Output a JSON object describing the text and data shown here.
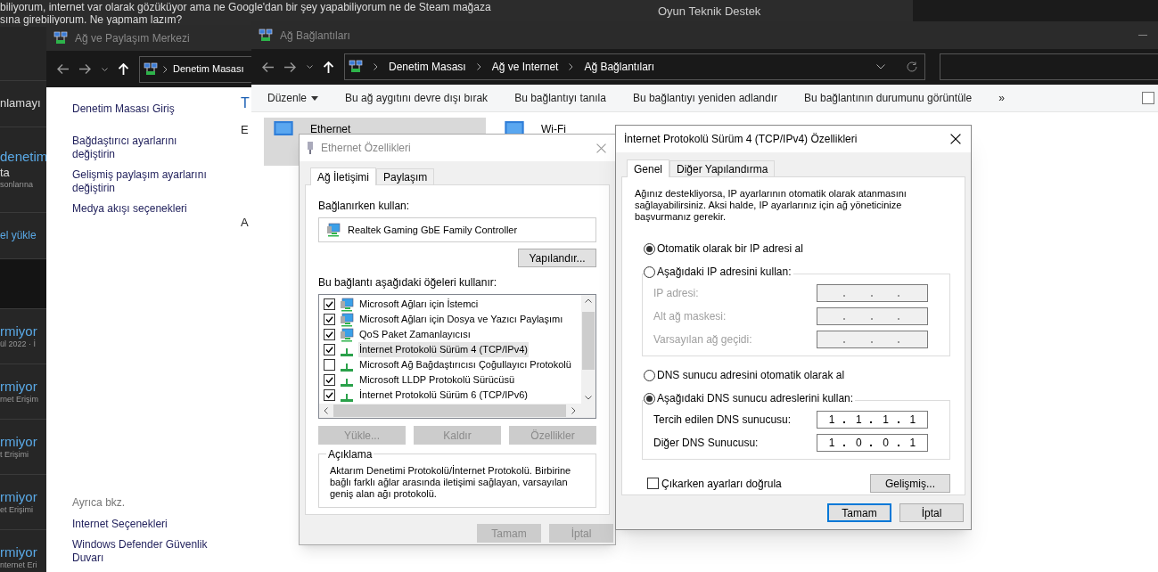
{
  "forum": {
    "post_lines": [
      "biliyorum, internet var olarak gözüküyor ama ne Google'dan bir şey yapabiliyorum ne de Steam mağaza",
      "sına girebiliyorum. Ne yapmam lazım?"
    ],
    "side_link": "Oyun Teknik Destek",
    "groups": [
      {
        "kind": "short",
        "lines": [
          {
            "text": "nlamayı",
            "kind": "plain"
          }
        ]
      },
      {
        "kind": "tall",
        "lines": [
          {
            "text": "denetim",
            "kind": "title"
          },
          {
            "text": "ta",
            "kind": "plain"
          },
          {
            "text": "sonlarına",
            "kind": "meta"
          }
        ]
      },
      {
        "kind": "short",
        "lines": [
          {
            "text": "el yükle",
            "kind": "link"
          }
        ]
      },
      {
        "kind": "band"
      },
      {
        "kind": "topic",
        "lines": [
          {
            "text": "rmiyor",
            "kind": "title"
          },
          {
            "text": "ül 2022 · İ",
            "kind": "meta"
          }
        ]
      },
      {
        "kind": "topic",
        "lines": [
          {
            "text": "rmiyor",
            "kind": "title"
          },
          {
            "text": "rnet Erişim",
            "kind": "meta"
          }
        ]
      },
      {
        "kind": "topic",
        "lines": [
          {
            "text": "rmiyor",
            "kind": "title"
          },
          {
            "text": "t Erişimi",
            "kind": "meta"
          }
        ]
      },
      {
        "kind": "topic",
        "lines": [
          {
            "text": "rmiyor",
            "kind": "title"
          },
          {
            "text": "et Erişimi",
            "kind": "meta"
          }
        ]
      },
      {
        "kind": "topic",
        "lines": [
          {
            "text": "rmiyor",
            "kind": "title"
          },
          {
            "text": "nternet Eri",
            "kind": "meta"
          }
        ]
      }
    ]
  },
  "network_center": {
    "title": "Ağ ve Paylaşım Merkezi",
    "breadcrumb": [
      "Denetim Masası"
    ],
    "links": [
      "Denetim Masası Giriş",
      "Bağdaştırıcı ayarlarını değiştirin",
      "Gelişmiş paylaşım ayarlarını değiştirin",
      "Medya akışı seçenekleri"
    ],
    "see_also_label": "Ayrıca bkz.",
    "see_also": [
      "Internet Seçenekleri",
      "Windows Defender Güvenlik Duvarı"
    ],
    "fragments": [
      {
        "text": "T",
        "kind": "link"
      },
      {
        "text": "E",
        "kind": "plain"
      },
      {
        "text": "A",
        "kind": "plain"
      }
    ]
  },
  "connections": {
    "title": "Ağ Bağlantıları",
    "breadcrumb": [
      "Denetim Masası",
      "Ağ ve Internet",
      "Ağ Bağlantıları"
    ],
    "commands": [
      {
        "label": "Düzenle",
        "kind": "menu"
      },
      {
        "label": "Bu ağ aygıtını devre dışı bırak",
        "kind": "plain"
      },
      {
        "label": "Bu bağlantıyı tanıla",
        "kind": "plain"
      },
      {
        "label": "Bu bağlantıyı yeniden adlandır",
        "kind": "plain"
      },
      {
        "label": "Bu bağlantının durumunu görüntüle",
        "kind": "plain"
      },
      {
        "label": "»",
        "kind": "more"
      }
    ],
    "items": [
      {
        "name": "Ethernet",
        "selected": true
      },
      {
        "name": "Wi-Fi",
        "selected": false
      }
    ]
  },
  "ethernet_props": {
    "title": "Ethernet Özellikleri",
    "tabs": [
      {
        "label": "Ağ İletişimi",
        "selected": true
      },
      {
        "label": "Paylaşım",
        "selected": false
      }
    ],
    "connect_label": "Bağlanırken kullan:",
    "adapter": "Realtek Gaming GbE Family Controller",
    "configure": "Yapılandır...",
    "items_label": "Bu bağlantı aşağıdaki öğeleri kullanır:",
    "items": [
      {
        "label": "Microsoft Ağları için İstemci",
        "kind": "client",
        "checked": true,
        "selected": false
      },
      {
        "label": "Microsoft Ağları için Dosya ve Yazıcı Paylaşımı",
        "kind": "client",
        "checked": true,
        "selected": false
      },
      {
        "label": "QoS Paket Zamanlayıcısı",
        "kind": "client",
        "checked": true,
        "selected": false
      },
      {
        "label": "İnternet Protokolü Sürüm 4 (TCP/IPv4)",
        "kind": "protocol",
        "checked": true,
        "selected": true
      },
      {
        "label": "Microsoft Ağ Bağdaştırıcısı Çoğullayıcı Protokolü",
        "kind": "protocol",
        "checked": false,
        "selected": false
      },
      {
        "label": "Microsoft LLDP Protokolü Sürücüsü",
        "kind": "protocol",
        "checked": true,
        "selected": false
      },
      {
        "label": "İnternet Protokolü Sürüm 6 (TCP/IPv6)",
        "kind": "protocol",
        "checked": true,
        "selected": false
      }
    ],
    "actions": [
      {
        "label": "Yükle...",
        "disabled": true
      },
      {
        "label": "Kaldır",
        "disabled": true
      },
      {
        "label": "Özellikler",
        "disabled": true
      }
    ],
    "description_label": "Açıklama",
    "description": "Aktarım Denetimi Protokolü/İnternet Protokolü. Birbirine bağlı farklı ağlar arasında iletişimi sağlayan, varsayılan geniş alan ağı protokolü.",
    "buttons": [
      {
        "label": "Tamam",
        "disabled": true
      },
      {
        "label": "İptal",
        "disabled": true
      }
    ]
  },
  "ipv4": {
    "title": "İnternet Protokolü Sürüm 4 (TCP/IPv4) Özellikleri",
    "tabs": [
      {
        "label": "Genel",
        "selected": true
      },
      {
        "label": "Diğer Yapılandırma",
        "selected": false
      }
    ],
    "intro": "Ağınız destekliyorsa, IP ayarlarının otomatik olarak atanmasını sağlayabilirsiniz. Aksi halde, IP ayarlarınız için ağ yöneticinize başvurmanız gerekir.",
    "ip_options": [
      {
        "label": "Otomatik olarak bir IP adresi al",
        "selected": true
      },
      {
        "label": "Aşağıdaki IP adresini kullan:",
        "selected": false
      }
    ],
    "ip_fields": [
      {
        "label": "IP adresi:",
        "disabled": true
      },
      {
        "label": "Alt ağ maskesi:",
        "disabled": true
      },
      {
        "label": "Varsayılan ağ geçidi:",
        "disabled": true
      }
    ],
    "dns_options": [
      {
        "label": "DNS sunucu adresini otomatik olarak al",
        "selected": false
      },
      {
        "label": "Aşağıdaki DNS sunucu adreslerini kullan:",
        "selected": true
      }
    ],
    "dns_fields": [
      {
        "label": "Tercih edilen DNS sunucusu:",
        "disabled": false,
        "octets": [
          "1",
          "1",
          "1",
          "1"
        ]
      },
      {
        "label": "Diğer DNS Sunucusu:",
        "disabled": false,
        "octets": [
          "1",
          "0",
          "0",
          "1"
        ]
      }
    ],
    "validate": {
      "label": "Çıkarken ayarları doğrula",
      "checked": false
    },
    "advanced": "Gelişmiş...",
    "buttons": [
      {
        "label": "Tamam",
        "default": true
      },
      {
        "label": "İptal",
        "default": false
      }
    ]
  }
}
